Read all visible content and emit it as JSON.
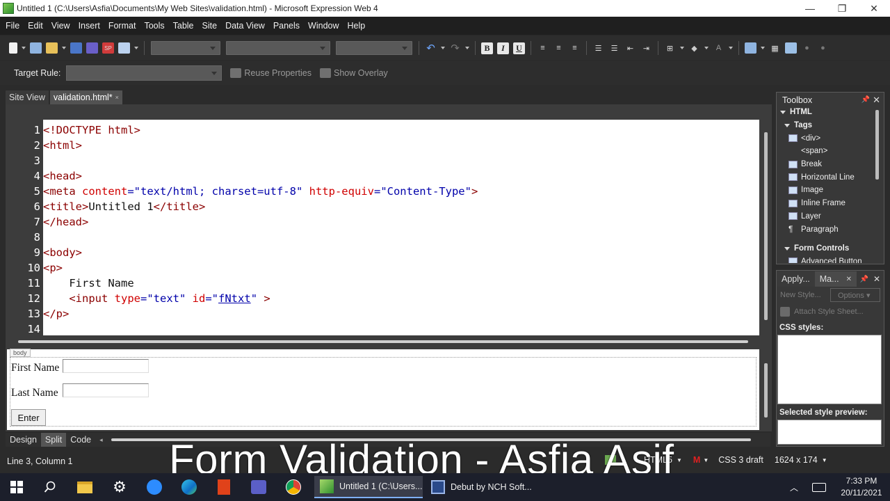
{
  "window": {
    "title": "Untitled 1 (C:\\Users\\Asfia\\Documents\\My Web Sites\\validation.html) - Microsoft Expression Web 4"
  },
  "menu": [
    "File",
    "Edit",
    "View",
    "Insert",
    "Format",
    "Tools",
    "Table",
    "Site",
    "Data View",
    "Panels",
    "Window",
    "Help"
  ],
  "formatting": {
    "bold": "B",
    "italic": "I",
    "underline": "U"
  },
  "toolbar2": {
    "target_rule_label": "Target Rule:",
    "reuse_properties": "Reuse Properties",
    "show_overlay": "Show Overlay"
  },
  "doc_tabs": {
    "site_view": "Site View",
    "active_file": "validation.html*",
    "close": "×"
  },
  "code": {
    "line_numbers": [
      "1",
      "2",
      "3",
      "4",
      "5",
      "6",
      "7",
      "8",
      "9",
      "10",
      "11",
      "12",
      "13",
      "14"
    ],
    "l1": "<!DOCTYPE html>",
    "l2": "<html>",
    "l4": "<head>",
    "l5_a": "<meta ",
    "l5_b": "content",
    "l5_c": "=",
    "l5_d": "\"text/html; charset=utf-8\"",
    "l5_e": " http-equiv",
    "l5_f": "=",
    "l5_g": "\"Content-Type\"",
    "l5_h": ">",
    "l6_a": "<title>",
    "l6_b": "Untitled 1",
    "l6_c": "</title>",
    "l7": "</head>",
    "l9": "<body>",
    "l10": "<p>",
    "l11": "    First Name",
    "l12_a": "    <input ",
    "l12_b": "type",
    "l12_c": "=",
    "l12_d": "\"text\"",
    "l12_e": " id",
    "l12_f": "=",
    "l12_g": "\"",
    "l12_h": "fNtxt",
    "l12_i": "\"",
    "l12_j": " >",
    "l13": "</p>"
  },
  "design": {
    "body_tag": "body",
    "first_name_label": "First Name",
    "last_name_label": "Last Name",
    "enter_button": "Enter"
  },
  "view_tabs": [
    "Design",
    "Split",
    "Code"
  ],
  "toolbox": {
    "title": "Toolbox",
    "items": [
      "HTML",
      "Tags",
      "<div>",
      "<span>",
      "Break",
      "Horizontal Line",
      "Image",
      "Inline Frame",
      "Layer",
      "Paragraph",
      "",
      "Form Controls",
      "Advanced Button"
    ]
  },
  "styles_panel": {
    "tab_apply": "Apply...",
    "tab_manage": "Ma...",
    "new_style": "New Style...",
    "options": "Options ▾",
    "attach": "Attach Style Sheet...",
    "css_styles": "CSS styles:",
    "preview": "Selected style preview:"
  },
  "status": {
    "position": "Line 3, Column 1",
    "html5": "HTML5",
    "css": "CSS 3 draft",
    "size": "1624 x 174"
  },
  "caption": "Form Validation - Asfia Asif",
  "taskbar": {
    "app1": "Untitled 1 (C:\\Users...",
    "app2": "Debut by NCH Soft...",
    "time": "7:33 PM",
    "date": "20/11/2021"
  },
  "colors": {
    "tag": "#8b0000",
    "attr": "#d00000",
    "value": "#0000aa",
    "panel_bg": "#383838",
    "taskbar_bg": "#1c1f2b"
  }
}
